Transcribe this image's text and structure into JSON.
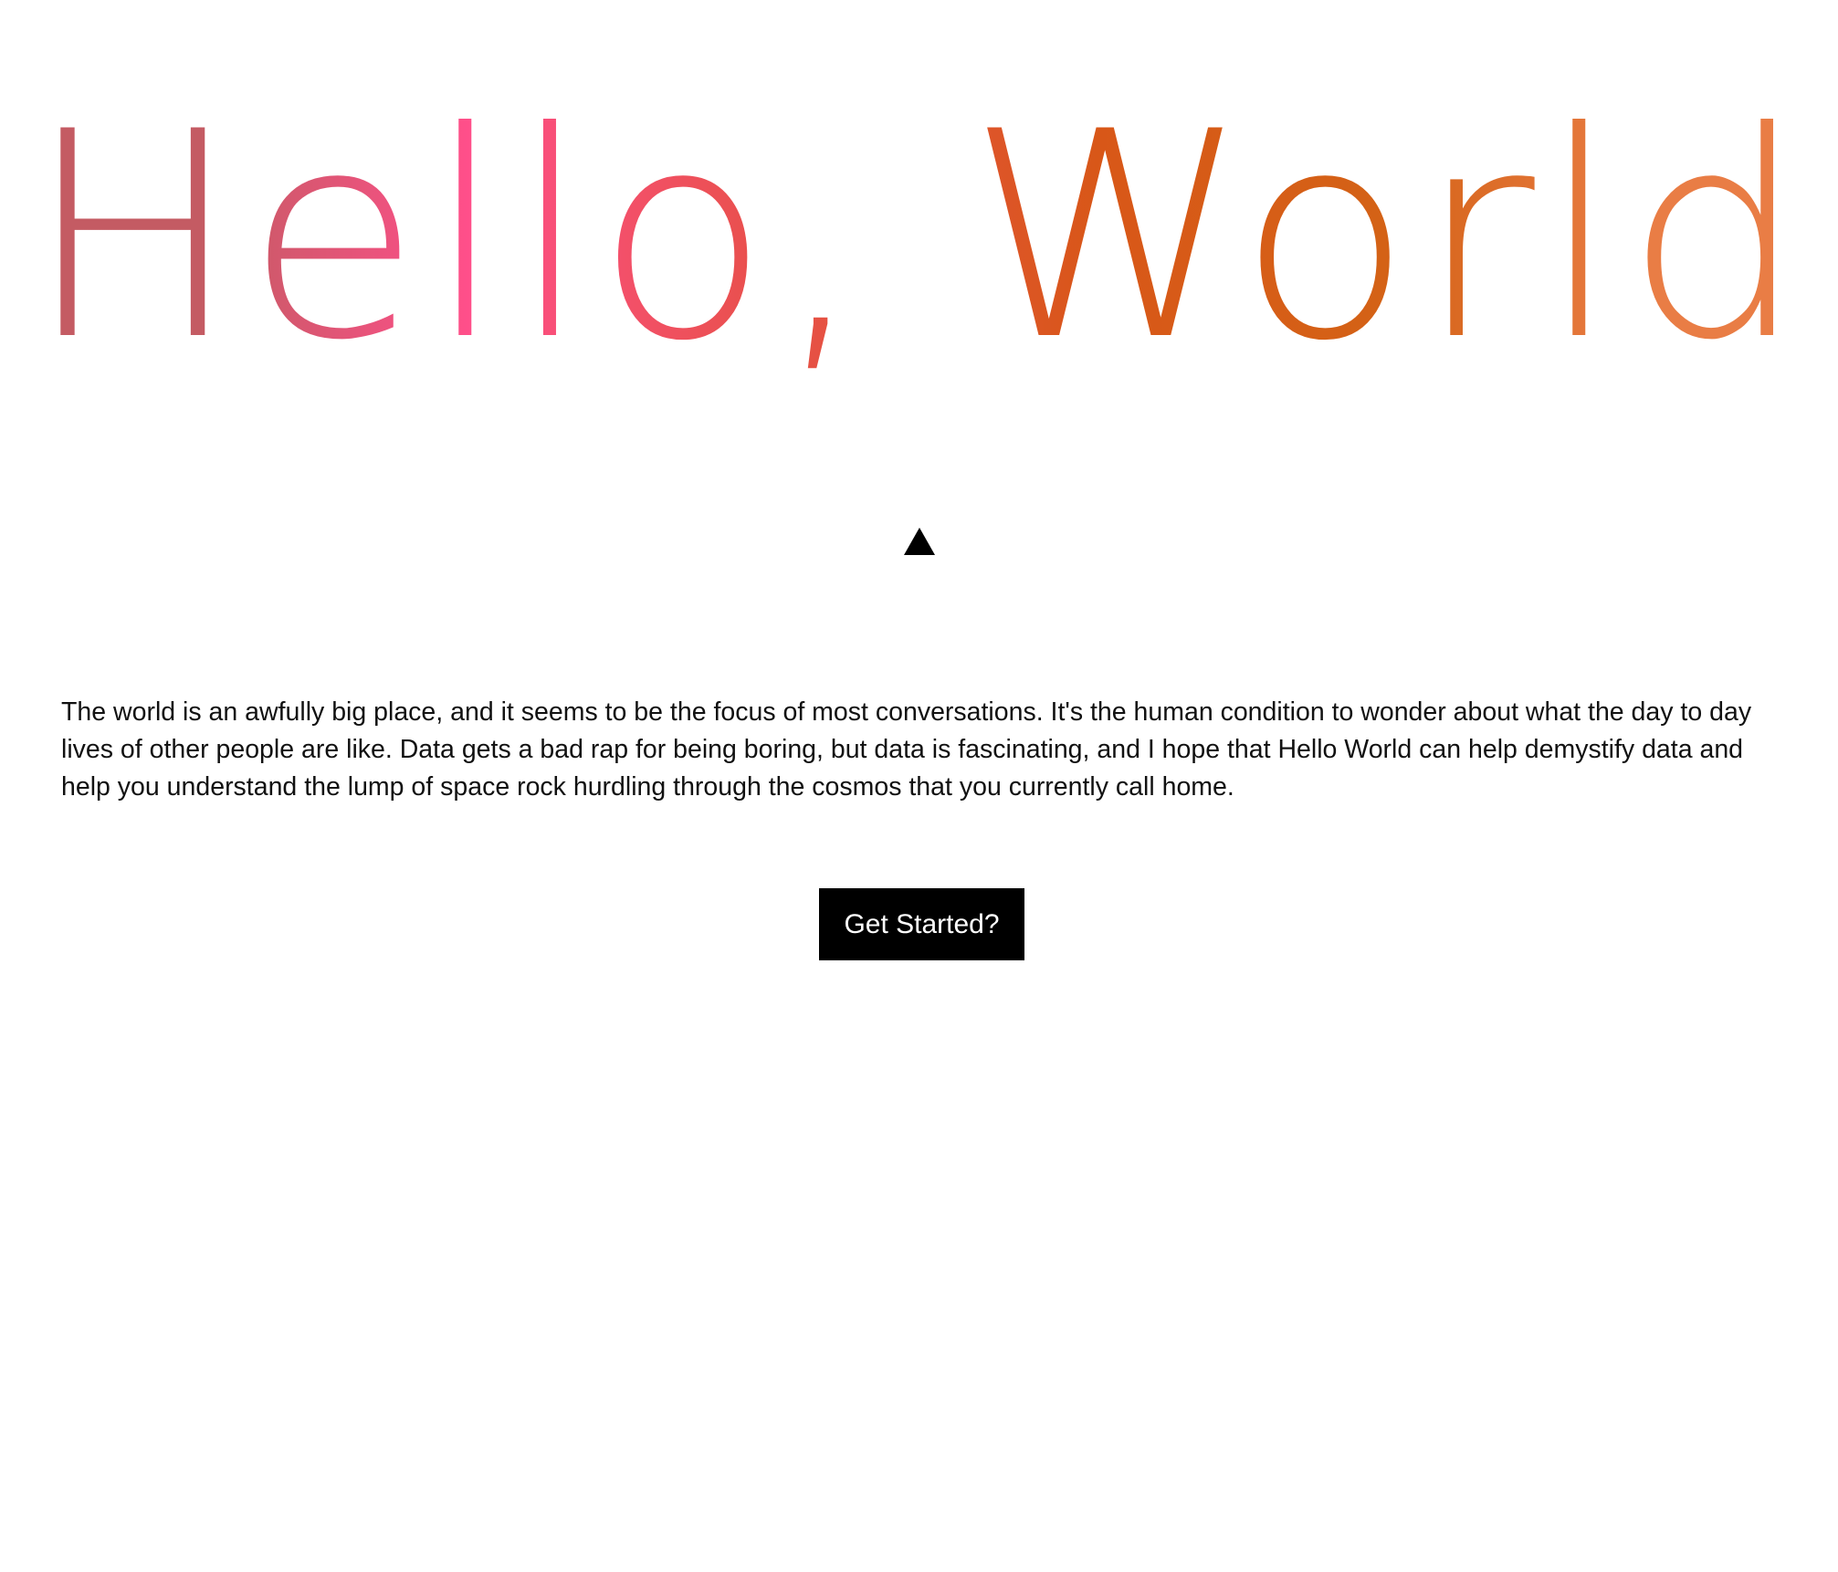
{
  "hero": {
    "title": "Hello, World",
    "gradient": [
      "#C45B63",
      "#FF4F8A",
      "#E9504D",
      "#D85718",
      "#D46216",
      "#E97D45"
    ]
  },
  "scroll_indicator": {
    "icon": "triangle-up-icon"
  },
  "intro": {
    "text": "The world is an awfully big place, and it seems to be the focus of most conversations. It's the human condition to wonder about what the day to day lives of other people are like. Data gets a bad rap for being boring, but data is fascinating, and I hope that Hello World can help demystify data and help you understand the lump of space rock hurdling through the cosmos that you currently call home."
  },
  "cta": {
    "label": "Get Started?",
    "background_color": "#000000",
    "text_color": "#FFFFFF"
  }
}
